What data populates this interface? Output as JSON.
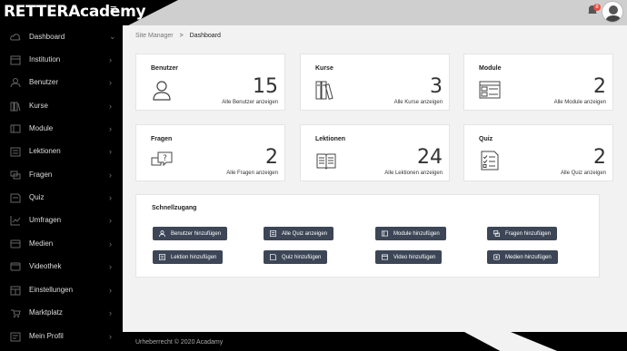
{
  "brand": "RETTERAcademy",
  "notifications_count": "8",
  "sidebar": {
    "items": [
      {
        "label": "Dashboard",
        "icon": "cloud-icon"
      },
      {
        "label": "Institution",
        "icon": "building-icon"
      },
      {
        "label": "Benutzer",
        "icon": "users-icon"
      },
      {
        "label": "Kurse",
        "icon": "books-icon"
      },
      {
        "label": "Module",
        "icon": "module-icon"
      },
      {
        "label": "Lektionen",
        "icon": "lesson-icon"
      },
      {
        "label": "Fragen",
        "icon": "question-icon"
      },
      {
        "label": "Quiz",
        "icon": "quiz-icon"
      },
      {
        "label": "Umfragen",
        "icon": "chart-icon"
      },
      {
        "label": "Medien",
        "icon": "media-icon"
      },
      {
        "label": "Videothek",
        "icon": "video-icon"
      },
      {
        "label": "Einstellungen",
        "icon": "settings-icon"
      },
      {
        "label": "Marktplatz",
        "icon": "market-icon"
      },
      {
        "label": "Mein Profil",
        "icon": "profile-icon"
      }
    ]
  },
  "breadcrumb": {
    "parent": "Site Manager",
    "separator": ">",
    "current": "Dashboard"
  },
  "cards": [
    {
      "title": "Benutzer",
      "value": "15",
      "link": "Alle Benutzer anzeigen",
      "icon": "user-icon"
    },
    {
      "title": "Kurse",
      "value": "3",
      "link": "Alle Kurse anzeigen",
      "icon": "books-icon"
    },
    {
      "title": "Module",
      "value": "2",
      "link": "Alle Module anzeigen",
      "icon": "module-icon"
    },
    {
      "title": "Fragen",
      "value": "2",
      "link": "Alle Fragen anzeigen",
      "icon": "question-bubble-icon"
    },
    {
      "title": "Lektionen",
      "value": "24",
      "link": "Alle Lektionen anzeigen",
      "icon": "open-book-icon"
    },
    {
      "title": "Quiz",
      "value": "2",
      "link": "Alle Quiz anzeigen",
      "icon": "quiz-checklist-icon"
    }
  ],
  "quick": {
    "title": "Schnellzugang",
    "buttons": [
      {
        "label": "Benutzer hinzufügen",
        "icon": "user-icon"
      },
      {
        "label": "Alle Quiz anzeigen",
        "icon": "quiz-icon"
      },
      {
        "label": "Module hinzufügen",
        "icon": "module-icon"
      },
      {
        "label": "Fragen hinzufügen",
        "icon": "question-icon"
      },
      {
        "label": "Lektion hinzufügen",
        "icon": "lesson-icon"
      },
      {
        "label": "Quiz hinzufügen",
        "icon": "quiz-icon"
      },
      {
        "label": "Video hinzufügen",
        "icon": "video-icon"
      },
      {
        "label": "Medien hinzufügen",
        "icon": "media-icon"
      }
    ]
  },
  "footer": "Urheberrecht © 2020 Acadamy",
  "colors": {
    "sidebar": "#000000",
    "topbar": "#cfcfcf",
    "button": "#3c4656",
    "badge": "#e74c3c"
  }
}
